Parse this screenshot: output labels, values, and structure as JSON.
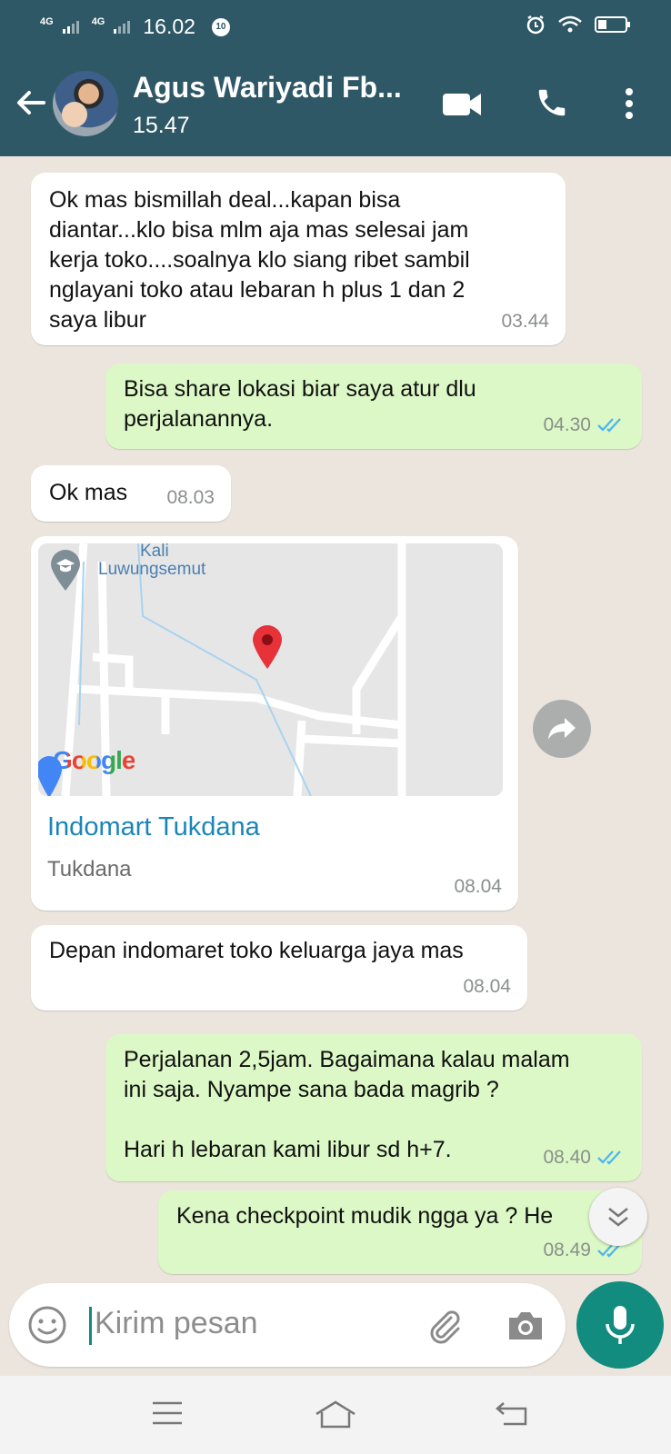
{
  "status_bar": {
    "net1": "4G",
    "net2": "4G",
    "time": "16.02",
    "badge": "10"
  },
  "header": {
    "contact_name": "Agus Wariyadi Fb...",
    "last_seen": "15.47"
  },
  "messages": [
    {
      "direction": "in",
      "text": "Ok mas bismillah deal...kapan bisa\ndiantar...klo bisa mlm aja mas selesai jam\nkerja toko....soalnya klo siang ribet sambil\nnglayani toko atau lebaran h plus 1 dan 2\nsaya libur",
      "time": "03.44"
    },
    {
      "direction": "out",
      "text": "Bisa share lokasi biar saya atur dlu\nperjalanannya.",
      "time": "04.30",
      "read": true
    },
    {
      "direction": "in",
      "text": "Ok mas",
      "time": "08.03"
    },
    {
      "direction": "in",
      "type": "location",
      "place_name": "Indomart Tukdana",
      "place_sub": "Tukdana",
      "time": "08.04",
      "map": {
        "label_river_top": "Kali",
        "label_river": "Luwungsemut",
        "logo_text": "Google"
      }
    },
    {
      "direction": "in",
      "text": "Depan indomaret toko keluarga jaya mas",
      "time": "08.04"
    },
    {
      "direction": "out",
      "text": "Perjalanan 2,5jam. Bagaimana kalau malam\nini saja. Nyampe sana bada magrib ?\n\nHari h lebaran kami libur sd h+7.",
      "time": "08.40",
      "read": true
    },
    {
      "direction": "out",
      "text": "Kena checkpoint mudik ngga ya ? He",
      "time": "08.49",
      "read": true
    }
  ],
  "input": {
    "placeholder": "Kirim pesan"
  },
  "colors": {
    "header": "#2f5866",
    "outgoing_bubble": "#dcf8c6",
    "incoming_bubble": "#ffffff",
    "accent": "#128c7e",
    "read_tick": "#4fb6ec"
  },
  "icons": [
    "back-arrow-icon",
    "video-call-icon",
    "phone-icon",
    "more-options-icon",
    "emoji-icon",
    "attach-icon",
    "camera-icon",
    "mic-icon",
    "forward-icon",
    "scroll-down-icon",
    "menu-nav-icon",
    "home-nav-icon",
    "back-nav-icon"
  ]
}
